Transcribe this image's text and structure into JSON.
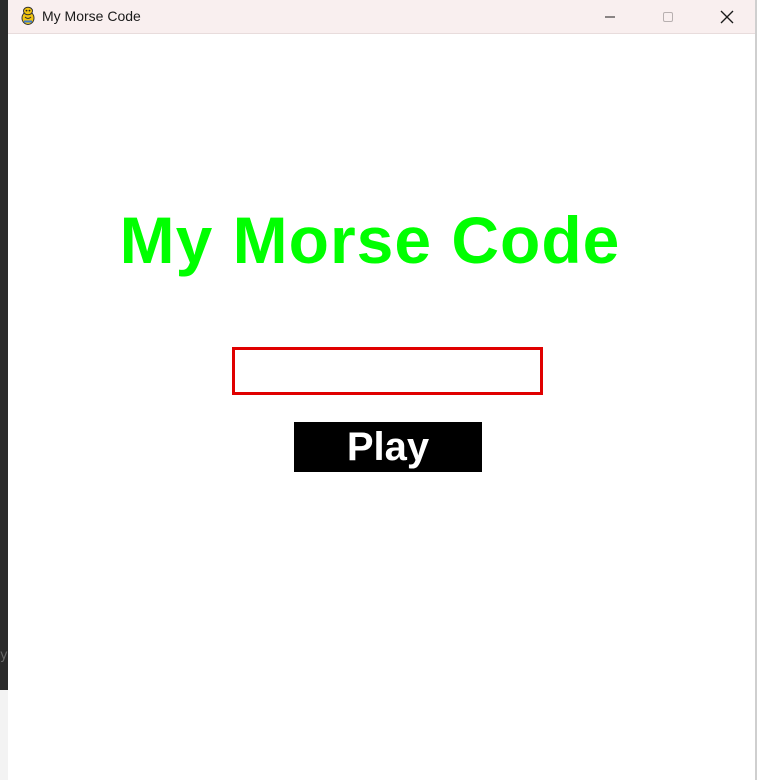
{
  "window": {
    "title": "My Morse Code",
    "icon": "pygame-snake-icon",
    "controls": {
      "minimize_icon": "minimize-icon",
      "maximize_icon": "maximize-icon",
      "close_icon": "close-icon"
    }
  },
  "background": {
    "partial_letter": "y"
  },
  "main": {
    "title": "My Morse Code",
    "title_color": "#00ff00",
    "input": {
      "value": "",
      "border_color": "#e00000"
    },
    "play_button": {
      "label": "Play",
      "bg_color": "#000000",
      "text_color": "#ffffff"
    }
  }
}
